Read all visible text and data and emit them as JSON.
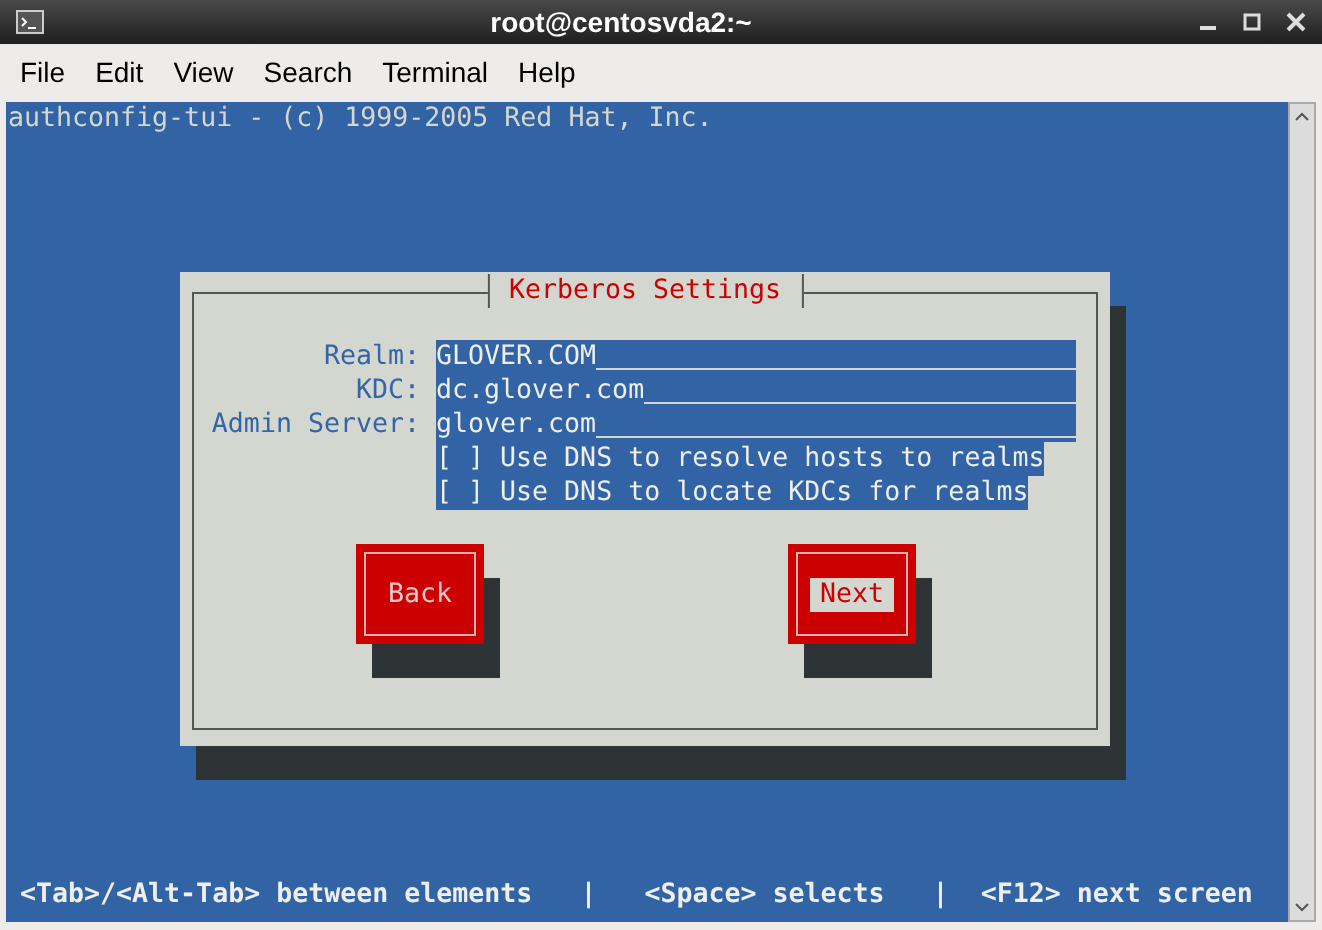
{
  "window": {
    "title": "root@centosvda2:~"
  },
  "menu": [
    "File",
    "Edit",
    "View",
    "Search",
    "Terminal",
    "Help"
  ],
  "terminal": {
    "header": "authconfig-tui - (c) 1999-2005 Red Hat, Inc.",
    "dialog": {
      "title": "Kerberos Settings",
      "fields": [
        {
          "label": "Realm:",
          "value": "GLOVER.COM"
        },
        {
          "label": "KDC:",
          "value": "dc.glover.com"
        },
        {
          "label": "Admin Server:",
          "value": "glover.com"
        }
      ],
      "checkboxes": [
        {
          "box": "[ ]",
          "label": "Use DNS to resolve hosts to realms",
          "checked": false
        },
        {
          "box": "[ ]",
          "label": "Use DNS to locate KDCs for realms",
          "checked": false
        }
      ],
      "buttons": [
        {
          "label": "Back",
          "selected": false
        },
        {
          "label": "Next",
          "selected": true
        }
      ]
    },
    "status_bar": "<Tab>/<Alt-Tab> between elements   |   <Space> selects   |  <F12> next screen"
  }
}
